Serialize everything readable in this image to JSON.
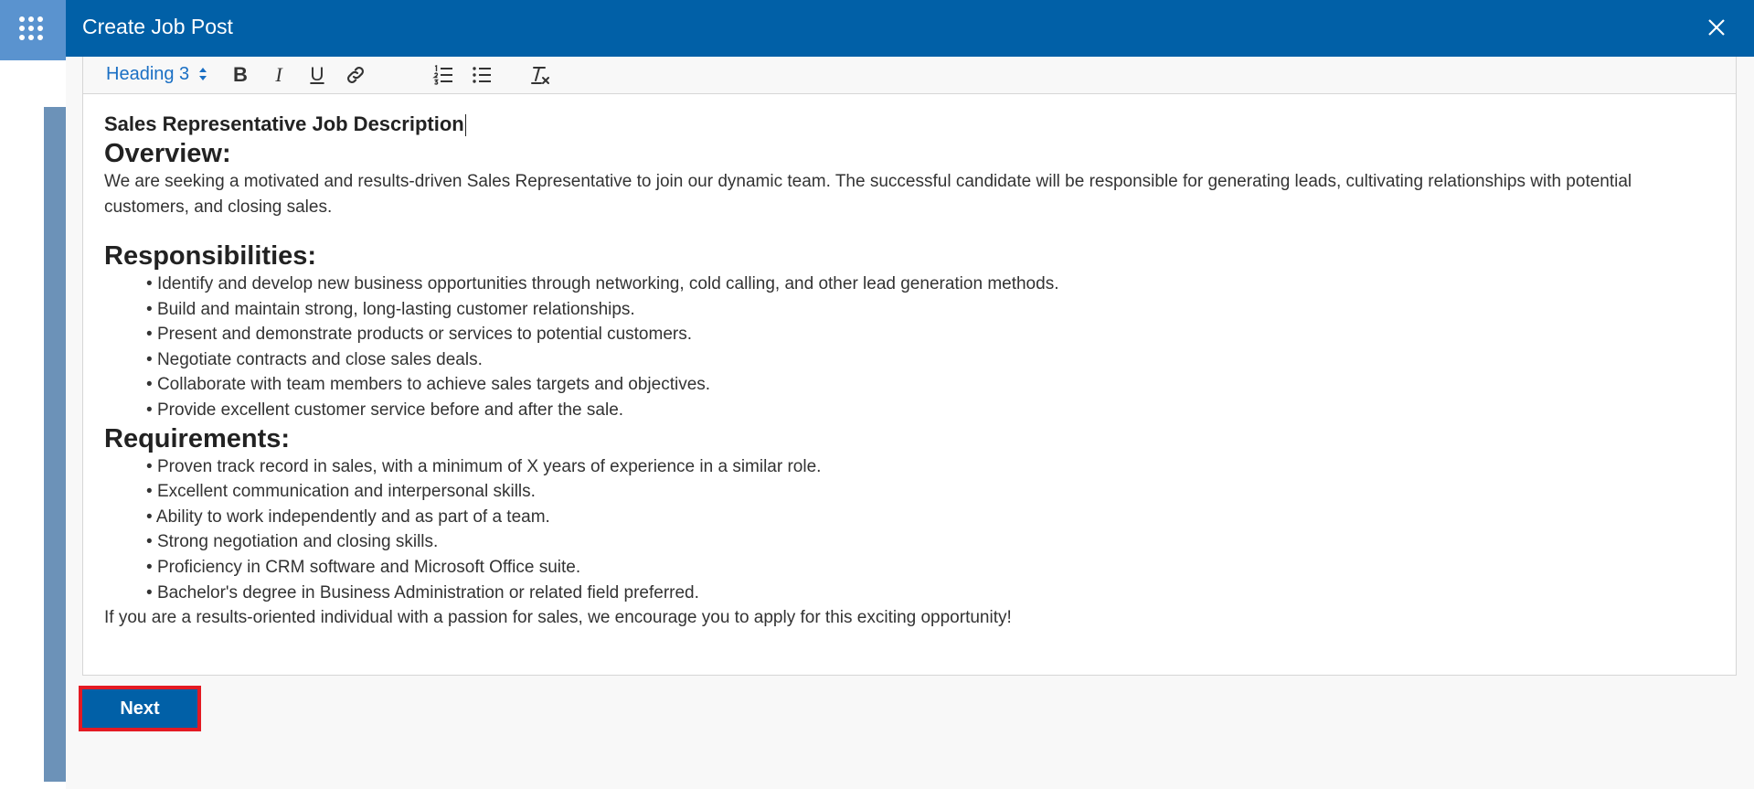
{
  "dialog": {
    "title": "Create Job Post"
  },
  "toolbar": {
    "format_value": "Heading 3",
    "bold_label": "B",
    "italic_label": "I",
    "underline_label": "U",
    "icons": [
      "link-icon",
      "numbered-list-icon",
      "bullet-list-icon",
      "clear-formatting-icon"
    ]
  },
  "editor": {
    "title": "Sales Representative Job Description",
    "overview_heading": "Overview:",
    "overview_text": "We are seeking a motivated and results-driven Sales Representative to join our dynamic team. The successful candidate will be responsible for generating leads, cultivating relationships with potential customers, and closing sales.",
    "responsibilities_heading": "Responsibilities:",
    "responsibilities": [
      "Identify and develop new business opportunities through networking, cold calling, and other lead generation methods.",
      "Build and maintain strong, long-lasting customer relationships.",
      "Present and demonstrate products or services to potential customers.",
      "Negotiate contracts and close sales deals.",
      "Collaborate with team members to achieve sales targets and objectives.",
      "Provide excellent customer service before and after the sale."
    ],
    "requirements_heading": "Requirements:",
    "requirements": [
      "Proven track record in sales, with a minimum of X years of experience in a similar role.",
      "Excellent communication and interpersonal skills.",
      "Ability to work independently and as part of a team.",
      "Strong negotiation and closing skills.",
      "Proficiency in CRM software and Microsoft Office suite.",
      "Bachelor's degree in Business Administration or related field preferred."
    ],
    "closing": "If you are a results-oriented individual with a passion for sales, we encourage you to apply for this exciting opportunity!"
  },
  "actions": {
    "next_label": "Next"
  },
  "colors": {
    "header_blue": "#0160a7",
    "highlight_red": "#e31a23",
    "link_blue": "#1a6fc4"
  }
}
